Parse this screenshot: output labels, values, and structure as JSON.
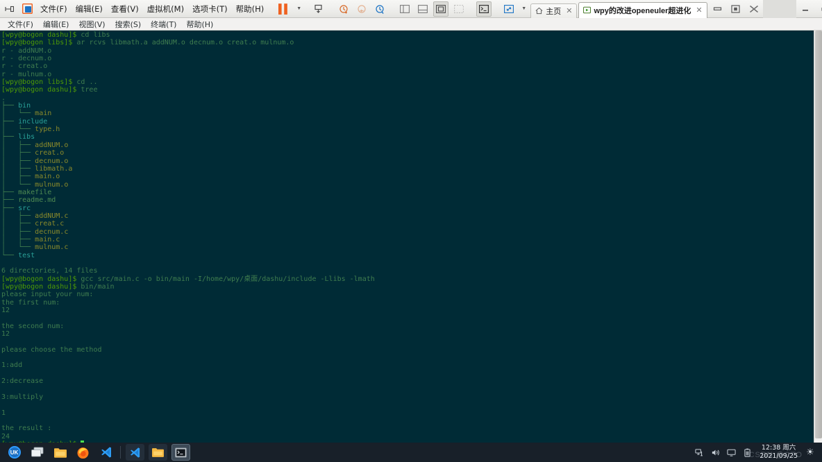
{
  "vmware": {
    "menus": [
      {
        "label": "文件(F)",
        "mnemonic": "F"
      },
      {
        "label": "编辑(E)",
        "mnemonic": "E"
      },
      {
        "label": "查看(V)",
        "mnemonic": "V"
      },
      {
        "label": "虚拟机(M)",
        "mnemonic": "M"
      },
      {
        "label": "选项卡(T)",
        "mnemonic": "T"
      },
      {
        "label": "帮助(H)",
        "mnemonic": "H"
      }
    ],
    "icons": {
      "send_ctrl_alt_del": "send-key-icon",
      "vm_library": "vm-library-icon",
      "pause": "pause-icon",
      "pause_caret": "chevron-down-icon",
      "snapshot": "snapshot-icon",
      "revert_snapshot": "revert-snapshot-icon",
      "snapshot_back": "snapshot-back-icon",
      "snapshot_manager": "snapshot-manager-icon",
      "show_library": "show-library-panel-icon",
      "show_thumbnails": "show-thumbnail-bar-icon",
      "full_screen": "full-screen-icon",
      "unity": "unity-mode-icon",
      "console": "console-view-icon",
      "stretch": "stretch-guest-icon",
      "stretch_caret": "chevron-down-icon"
    },
    "tabs": [
      {
        "label": "主页",
        "icon": "home-icon",
        "active": false,
        "closable": true
      },
      {
        "label": "wpy的改进openeuler超进化",
        "icon": "vm-running-icon",
        "active": true,
        "closable": true
      }
    ],
    "window_controls": {
      "restore_guest": "minimize-guest-icon",
      "maximize_guest": "maximize-guest-icon",
      "close_guest": "close-guest-icon",
      "minimize": "minimize-icon",
      "maximize": "maximize-icon",
      "close": "close-icon"
    }
  },
  "guest_menubar": {
    "items": [
      {
        "label": "文件(F)"
      },
      {
        "label": "编辑(E)"
      },
      {
        "label": "视图(V)"
      },
      {
        "label": "搜索(S)"
      },
      {
        "label": "终端(T)"
      },
      {
        "label": "帮助(H)"
      }
    ]
  },
  "terminal": {
    "prompt_user": "[wpy@bogon dashu]$",
    "prompt_libs": "[wpy@bogon libs]$",
    "background": "#002b36",
    "colors": {
      "prompt": "#4e9a06",
      "output": "#3f7d4f",
      "directory": "#2aa198",
      "file": "#8a8a2b",
      "cursor": "#4ee04e"
    },
    "lines": [
      {
        "type": "cmd",
        "prompt": "[wpy@bogon dashu]$",
        "text": " cd libs"
      },
      {
        "type": "cmd",
        "prompt": "[wpy@bogon libs]$",
        "text": " ar rcvs libmath.a addNUM.o decnum.o creat.o mulnum.o"
      },
      {
        "type": "out",
        "text": "r - addNUM.o"
      },
      {
        "type": "out",
        "text": "r - decnum.o"
      },
      {
        "type": "out",
        "text": "r - creat.o"
      },
      {
        "type": "out",
        "text": "r - mulnum.o"
      },
      {
        "type": "cmd",
        "prompt": "[wpy@bogon libs]$",
        "text": " cd .."
      },
      {
        "type": "cmd",
        "prompt": "[wpy@bogon dashu]$",
        "text": " tree"
      },
      {
        "type": "out",
        "text": "."
      },
      {
        "type": "tree",
        "branch": "├── ",
        "name": "bin",
        "kind": "dir",
        "indent": 0
      },
      {
        "type": "tree",
        "branch": "│   └── ",
        "name": "main",
        "kind": "file",
        "indent": 0
      },
      {
        "type": "tree",
        "branch": "├── ",
        "name": "include",
        "kind": "dir",
        "indent": 0
      },
      {
        "type": "tree",
        "branch": "│   └── ",
        "name": "type.h",
        "kind": "file",
        "indent": 0
      },
      {
        "type": "tree",
        "branch": "├── ",
        "name": "libs",
        "kind": "dir",
        "indent": 0
      },
      {
        "type": "tree",
        "branch": "│   ├── ",
        "name": "addNUM.o",
        "kind": "file",
        "indent": 0
      },
      {
        "type": "tree",
        "branch": "│   ├── ",
        "name": "creat.o",
        "kind": "file",
        "indent": 0
      },
      {
        "type": "tree",
        "branch": "│   ├── ",
        "name": "decnum.o",
        "kind": "file",
        "indent": 0
      },
      {
        "type": "tree",
        "branch": "│   ├── ",
        "name": "libmath.a",
        "kind": "file",
        "indent": 0
      },
      {
        "type": "tree",
        "branch": "│   ├── ",
        "name": "main.o",
        "kind": "file",
        "indent": 0
      },
      {
        "type": "tree",
        "branch": "│   └── ",
        "name": "mulnum.o",
        "kind": "file",
        "indent": 0
      },
      {
        "type": "tree",
        "branch": "├── ",
        "name": "makefile",
        "kind": "plain",
        "indent": 0
      },
      {
        "type": "tree",
        "branch": "├── ",
        "name": "readme.md",
        "kind": "plain",
        "indent": 0
      },
      {
        "type": "tree",
        "branch": "├── ",
        "name": "src",
        "kind": "dir",
        "indent": 0
      },
      {
        "type": "tree",
        "branch": "│   ├── ",
        "name": "addNUM.c",
        "kind": "file",
        "indent": 0
      },
      {
        "type": "tree",
        "branch": "│   ├── ",
        "name": "creat.c",
        "kind": "file",
        "indent": 0
      },
      {
        "type": "tree",
        "branch": "│   ├── ",
        "name": "decnum.c",
        "kind": "file",
        "indent": 0
      },
      {
        "type": "tree",
        "branch": "│   ├── ",
        "name": "main.c",
        "kind": "file",
        "indent": 0
      },
      {
        "type": "tree",
        "branch": "│   └── ",
        "name": "mulnum.c",
        "kind": "file",
        "indent": 0
      },
      {
        "type": "tree",
        "branch": "└── ",
        "name": "test",
        "kind": "dir",
        "indent": 0
      },
      {
        "type": "blank",
        "text": ""
      },
      {
        "type": "out",
        "text": "6 directories, 14 files"
      },
      {
        "type": "cmd",
        "prompt": "[wpy@bogon dashu]$",
        "text": " gcc src/main.c -o bin/main -I/home/wpy/桌面/dashu/include -Llibs -lmath"
      },
      {
        "type": "cmd",
        "prompt": "[wpy@bogon dashu]$",
        "text": " bin/main"
      },
      {
        "type": "out",
        "text": "please input your num:"
      },
      {
        "type": "out",
        "text": "the first num:"
      },
      {
        "type": "out",
        "text": "12"
      },
      {
        "type": "blank",
        "text": ""
      },
      {
        "type": "out",
        "text": "the second num:"
      },
      {
        "type": "out",
        "text": "12"
      },
      {
        "type": "blank",
        "text": ""
      },
      {
        "type": "out",
        "text": "please choose the method"
      },
      {
        "type": "blank",
        "text": ""
      },
      {
        "type": "out",
        "text": "1:add"
      },
      {
        "type": "blank",
        "text": ""
      },
      {
        "type": "out",
        "text": "2:decrease"
      },
      {
        "type": "blank",
        "text": ""
      },
      {
        "type": "out",
        "text": "3:multiply"
      },
      {
        "type": "blank",
        "text": ""
      },
      {
        "type": "out",
        "text": "1"
      },
      {
        "type": "blank",
        "text": ""
      },
      {
        "type": "out",
        "text": "the result :"
      },
      {
        "type": "out",
        "text": "24"
      },
      {
        "type": "cmd_cursor",
        "prompt": "[wpy@bogon dashu]$",
        "text": " "
      }
    ]
  },
  "taskbar": {
    "items": [
      {
        "name": "start-menu-button",
        "icon": "openeuler-logo-icon"
      },
      {
        "name": "show-desktop-button",
        "icon": "windows-stack-icon"
      },
      {
        "name": "file-manager-button",
        "icon": "folder-icon"
      },
      {
        "name": "firefox-button",
        "icon": "firefox-icon"
      },
      {
        "name": "vscode-button",
        "icon": "vscode-icon"
      }
    ],
    "pinned": [
      {
        "name": "taskbar-vscode-window",
        "icon": "vscode-icon",
        "active": false
      },
      {
        "name": "taskbar-files-window",
        "icon": "folder-icon",
        "active": false
      },
      {
        "name": "taskbar-terminal-window",
        "icon": "terminal-icon",
        "active": true
      }
    ],
    "tray": [
      {
        "name": "network-icon"
      },
      {
        "name": "volume-icon"
      },
      {
        "name": "display-icon"
      },
      {
        "name": "battery-icon"
      }
    ],
    "clock": {
      "time": "12:38 周六",
      "date": "2021/09/25"
    },
    "brightness_icon": "sun-icon",
    "watermark": "CSDN @CTO"
  }
}
